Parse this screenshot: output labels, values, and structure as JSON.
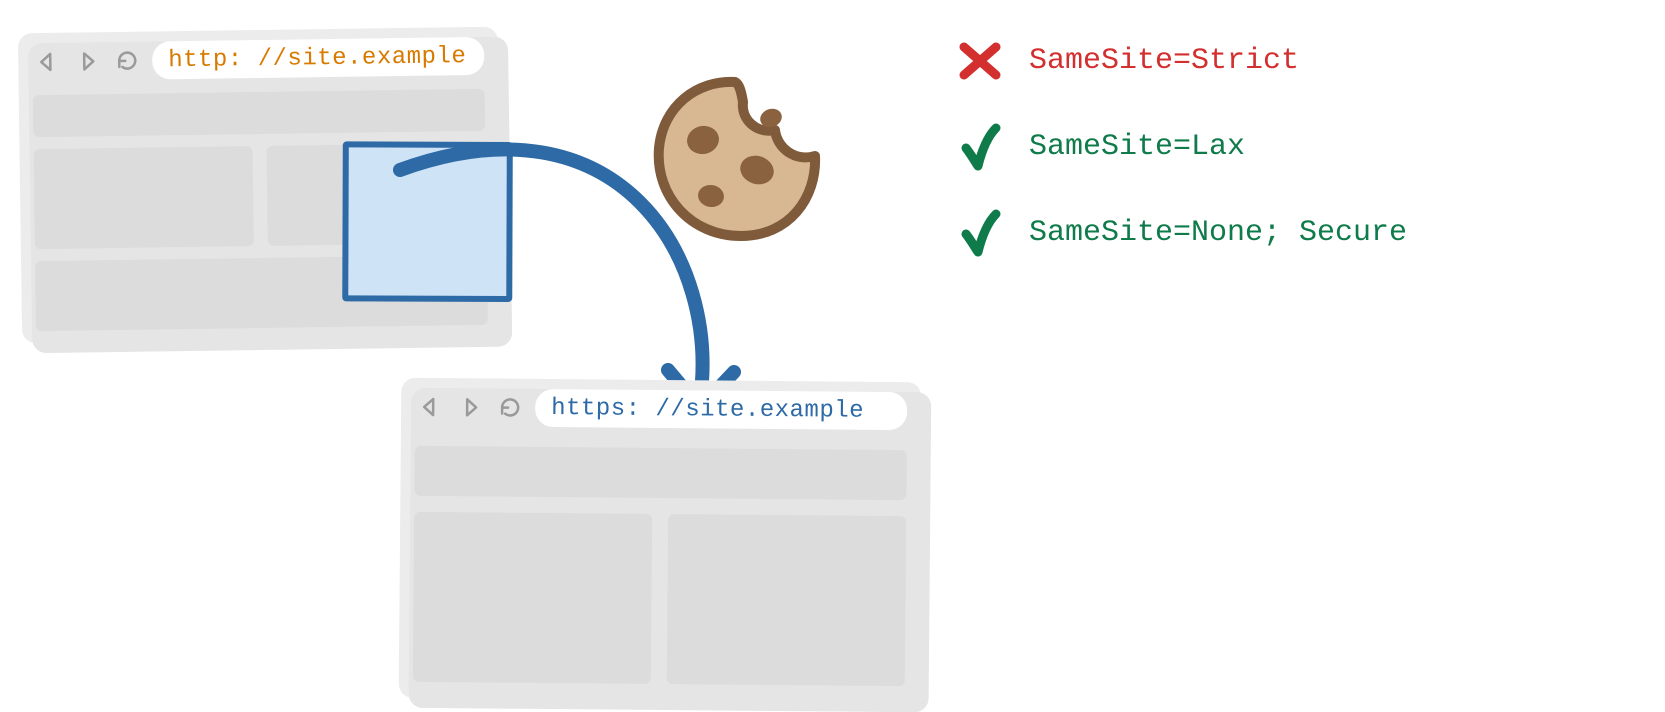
{
  "browserA": {
    "url": "http: //site.example"
  },
  "browserB": {
    "url": "https: //site.example"
  },
  "legend": {
    "rows": [
      {
        "status": "cross",
        "text": "SameSite=Strict"
      },
      {
        "status": "check",
        "text": "SameSite=Lax"
      },
      {
        "status": "check",
        "text": "SameSite=None; Secure"
      }
    ]
  }
}
